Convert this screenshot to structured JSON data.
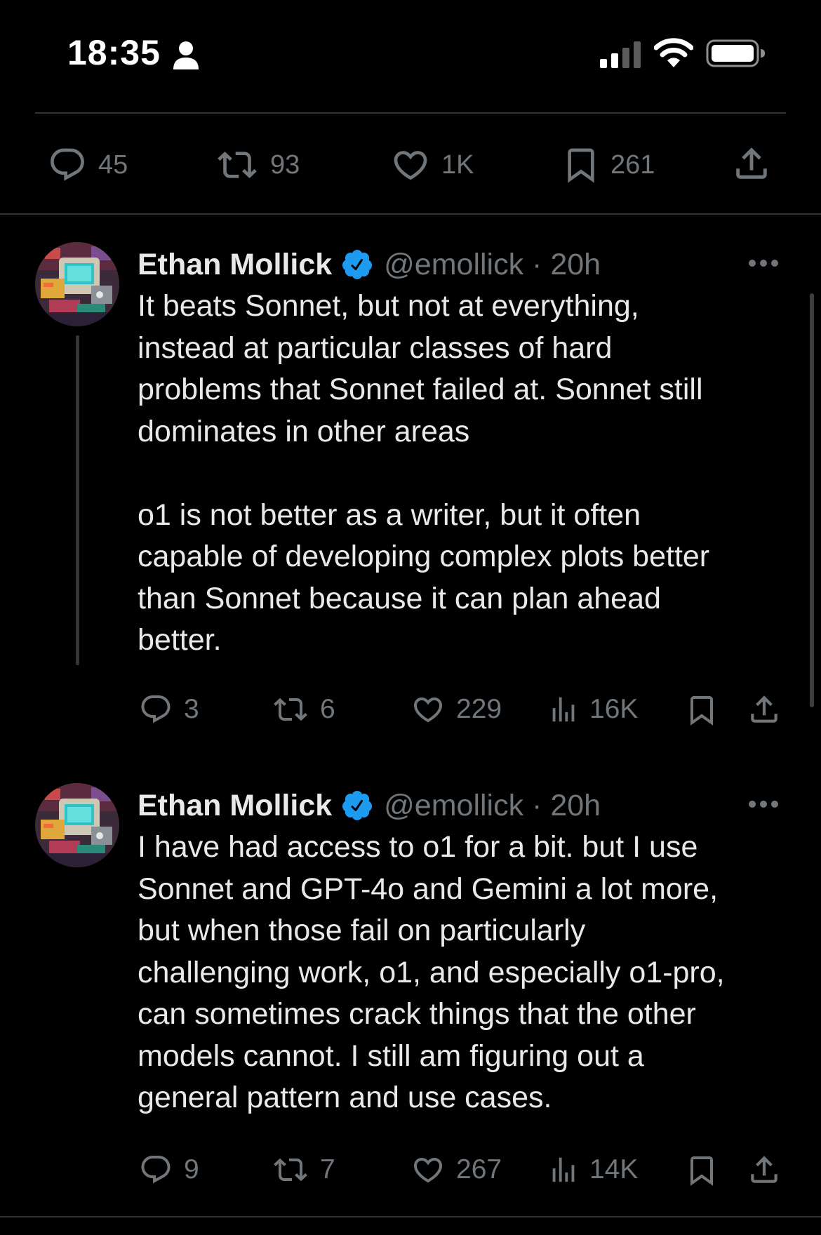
{
  "status_bar": {
    "time": "18:35",
    "icons": [
      "person-icon",
      "signal-icon",
      "wifi-icon",
      "battery-icon"
    ]
  },
  "top_actions": {
    "replies": "45",
    "reposts": "93",
    "likes": "1K",
    "bookmarks": "261"
  },
  "tweets": [
    {
      "author": "Ethan Mollick",
      "handle_time": "@emollick · 20h",
      "text": "It beats Sonnet, but not at everything,\ninstead at particular classes of hard\nproblems that Sonnet failed at. Sonnet still\ndominates in other areas\n\no1 is not better as a writer, but it often\ncapable of developing complex plots better\nthan Sonnet because it can plan ahead\nbetter.",
      "replies": "3",
      "reposts": "6",
      "likes": "229",
      "views": "16K"
    },
    {
      "author": "Ethan Mollick",
      "handle_time": "@emollick · 20h",
      "text": "I have had access to o1 for a bit. but I use\nSonnet and GPT-4o and Gemini a lot more,\nbut when those fail on particularly\nchallenging work, o1, and especially o1-pro,\ncan sometimes crack things that the other\nmodels cannot. I still am figuring out a\ngeneral pattern and use cases.",
      "replies": "9",
      "reposts": "7",
      "likes": "267",
      "views": "14K"
    }
  ],
  "colors": {
    "background": "#000000",
    "text": "#e7e9ea",
    "muted": "#71767b",
    "divider": "#2f3336",
    "verified": "#1d9bf0"
  }
}
